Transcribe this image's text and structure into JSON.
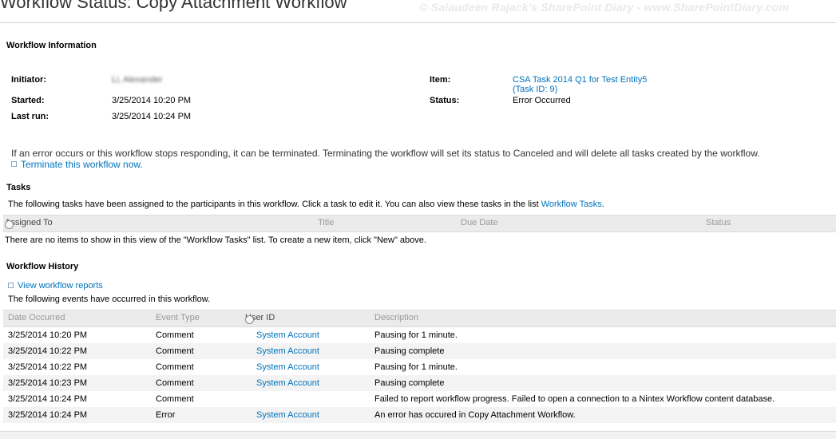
{
  "page": {
    "title": "Workflow Status: Copy Attachment Workflow",
    "watermark": "© Salaudeen Rajack's SharePoint Diary - www.SharePointDiary.com"
  },
  "workflow_info": {
    "heading": "Workflow Information",
    "initiator_label": "Initiator:",
    "initiator_value": "Li, Alexander",
    "started_label": "Started:",
    "started_value": "3/25/2014 10:20 PM",
    "last_run_label": "Last run:",
    "last_run_value": "3/25/2014 10:24 PM",
    "item_label": "Item:",
    "item_link_line1": "CSA Task 2014 Q1 for Test Entity5",
    "item_link_line2": "(Task ID: 9)",
    "status_label": "Status:",
    "status_value": "Error Occurred"
  },
  "terminate": {
    "message": "If an error occurs or this workflow stops responding, it can be terminated. Terminating the workflow will set its status to Canceled and will delete all tasks created by the workflow.",
    "link": "Terminate this workflow now."
  },
  "tasks": {
    "heading": "Tasks",
    "description": "The following tasks have been assigned to the participants in this workflow. Click a task to edit it. You can also view these tasks in the list",
    "list_link": "Workflow Tasks",
    "period": ".",
    "columns": [
      "Assigned To",
      "Title",
      "Due Date",
      "Status"
    ],
    "empty_message": "There are no items to show in this view of the \"Workflow Tasks\" list. To create a new item, click \"New\" above."
  },
  "history": {
    "heading": "Workflow History",
    "reports_link": "View workflow reports",
    "description": "The following events have occurred in this workflow.",
    "columns": [
      "Date Occurred",
      "Event Type",
      "User ID",
      "Description"
    ],
    "rows": [
      {
        "date": "3/25/2014 10:20 PM",
        "event": "Comment",
        "user": "System Account",
        "description": "Pausing for 1 minute."
      },
      {
        "date": "3/25/2014 10:22 PM",
        "event": "Comment",
        "user": "System Account",
        "description": "Pausing complete"
      },
      {
        "date": "3/25/2014 10:22 PM",
        "event": "Comment",
        "user": "System Account",
        "description": "Pausing for 1 minute."
      },
      {
        "date": "3/25/2014 10:23 PM",
        "event": "Comment",
        "user": "System Account",
        "description": "Pausing complete"
      },
      {
        "date": "3/25/2014 10:24 PM",
        "event": "Comment",
        "user": "",
        "description": "Failed to report workflow progress. Failed to open a connection to a Nintex Workflow content database."
      },
      {
        "date": "3/25/2014 10:24 PM",
        "event": "Error",
        "user": "System Account",
        "description": "An error has occured in Copy Attachment Workflow."
      }
    ]
  },
  "colors": {
    "link": "#0072bc",
    "header_bg": "#ebebeb",
    "alt_row_bg": "#f3f3f3"
  }
}
